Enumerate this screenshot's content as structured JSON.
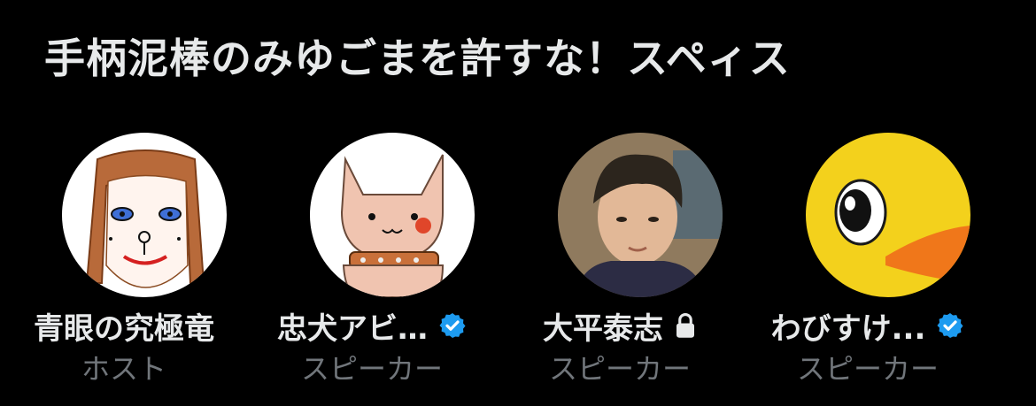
{
  "space": {
    "title": "手柄泥棒のみゆごまを許すな！スペィス"
  },
  "participants": [
    {
      "name": "青眼の究極竜",
      "role": "ホスト",
      "badge": ""
    },
    {
      "name": "忠犬アビ…",
      "role": "スピーカー",
      "badge": "verified-badge-icon"
    },
    {
      "name": "大平泰志",
      "role": "スピーカー",
      "badge": "lock-icon"
    },
    {
      "name": "わびすけ...",
      "role": "スピーカー",
      "badge": "verified-badge-icon"
    }
  ],
  "colors": {
    "background": "#000000",
    "name_text": "#e7e9ea",
    "role_text": "#71767b",
    "verified_blue": "#1d9bf0"
  }
}
